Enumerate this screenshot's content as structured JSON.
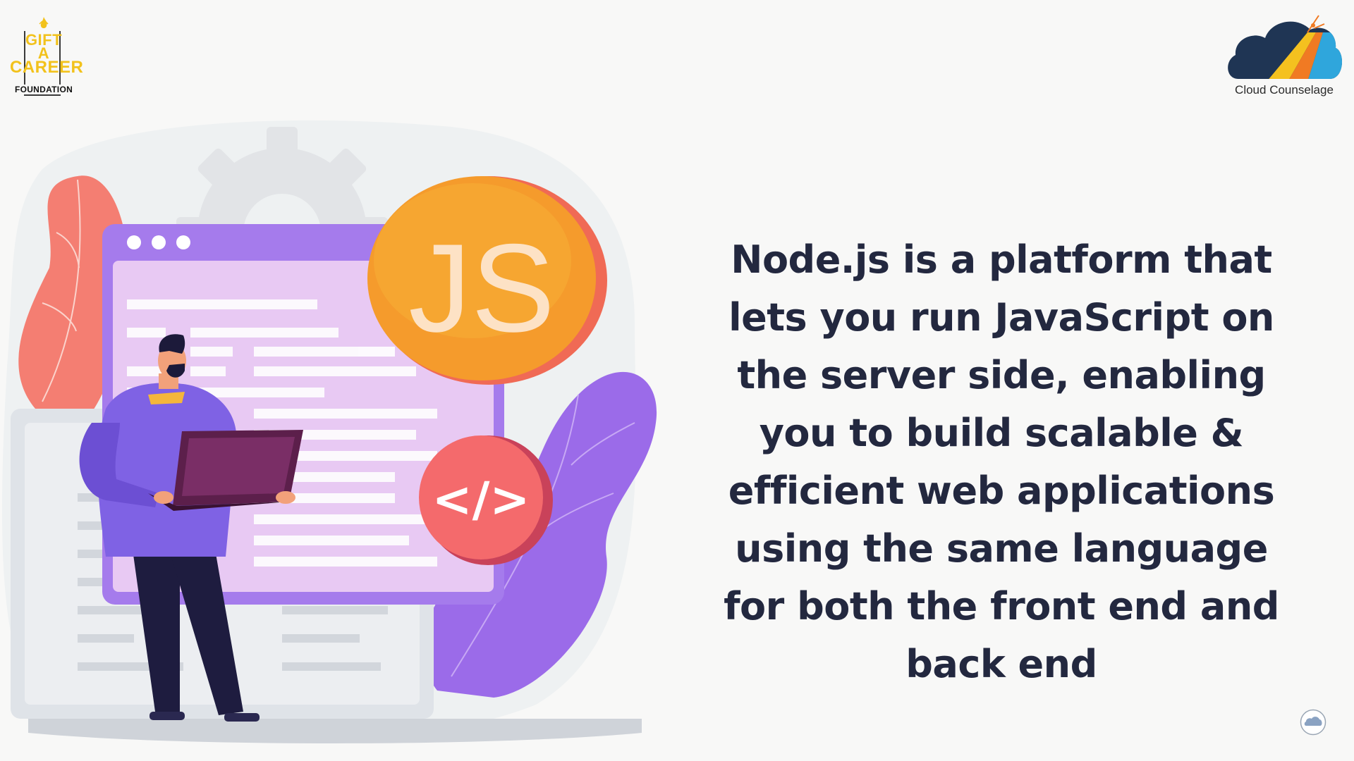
{
  "logos": {
    "gift_a_career": {
      "line1": "GIFT",
      "line2": "A",
      "line3": "CAREER",
      "subtitle": "FOUNDATION"
    },
    "cloud_counselage": {
      "label": "Cloud Counselage"
    }
  },
  "illustration": {
    "badge_js": "JS",
    "badge_code": "</>",
    "icons": [
      "browser-window-illustration",
      "gear-icon",
      "laptop-icon",
      "developer-figure"
    ]
  },
  "slide": {
    "text": "Node.js is a platform that lets you run JavaScript on the server side, enabling you to build scalable & efficient web applications using the same language for both the front end and back end"
  },
  "colors": {
    "text": "#23283f",
    "purple": "#9a6be8",
    "orange": "#f39a2b",
    "coral": "#f06a6a",
    "gold": "#f2c21c"
  }
}
